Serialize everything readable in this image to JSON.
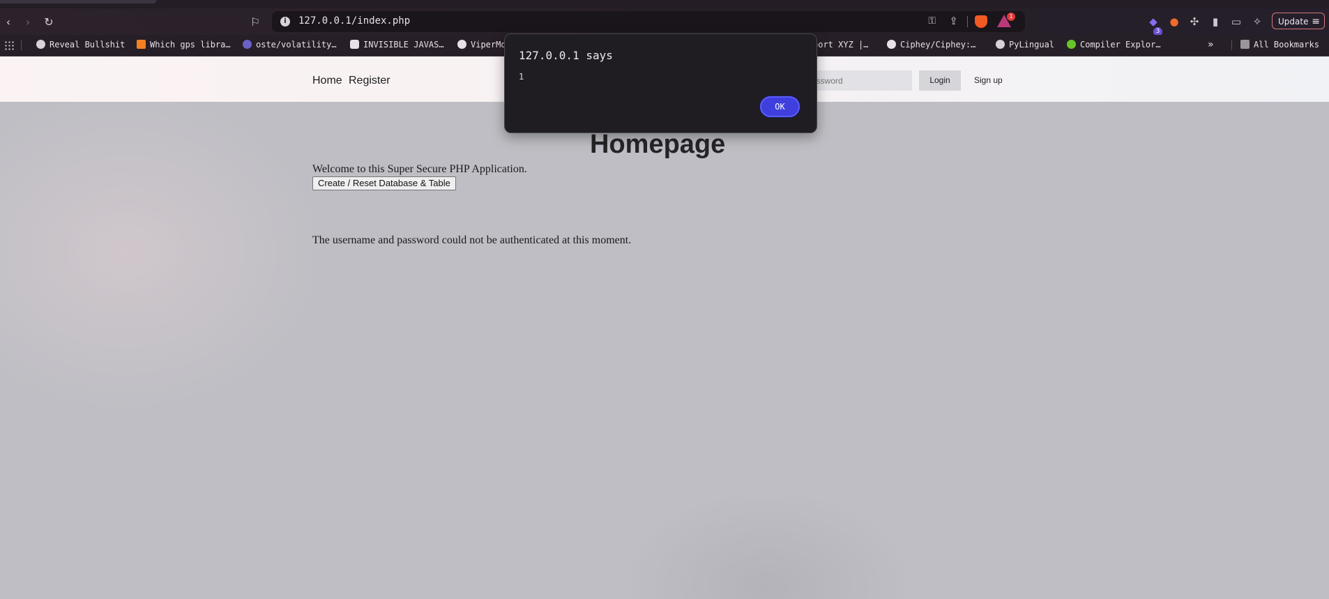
{
  "browser": {
    "url": "127.0.0.1/index.php",
    "update_label": "Update",
    "extension_badge": "3",
    "rewards_badge": "1",
    "bookmarks": [
      {
        "label": "Reveal Bullshit",
        "icon_color": "#d8d2d8"
      },
      {
        "label": "Which gps libra…",
        "icon_color": "#f48024"
      },
      {
        "label": "oste/volatility…",
        "icon_color": "#6a62c8"
      },
      {
        "label": "INVISIBLE JAVAS…",
        "icon_color": "#e8e2e8"
      },
      {
        "label": "ViperMo",
        "icon_color": "#e8e2e8"
      },
      {
        "label": "port XYZ |…",
        "icon_color": "#271f27"
      },
      {
        "label": "Ciphey/Ciphey:…",
        "icon_color": "#e8e2e8"
      },
      {
        "label": "PyLingual",
        "icon_color": "#d8d2d8"
      },
      {
        "label": "Compiler Explor…",
        "icon_color": "#67c52a"
      }
    ],
    "all_bookmarks_label": "All Bookmarks"
  },
  "nav": {
    "home": "Home",
    "register": "Register",
    "password_placeholder": "Password",
    "login": "Login",
    "signup": "Sign up"
  },
  "main": {
    "title": "Homepage",
    "welcome": "Welcome to this Super Secure PHP Application.",
    "reset_button": "Create / Reset Database & Table",
    "auth_message": "The username and password could not be authenticated at this moment."
  },
  "dialog": {
    "title": "127.0.0.1 says",
    "message": "1",
    "ok_label": "OK"
  },
  "colors": {
    "dialog_button": "#3e3fdc",
    "chrome_bg": "#271f27",
    "page_bg": "#bebec4"
  }
}
